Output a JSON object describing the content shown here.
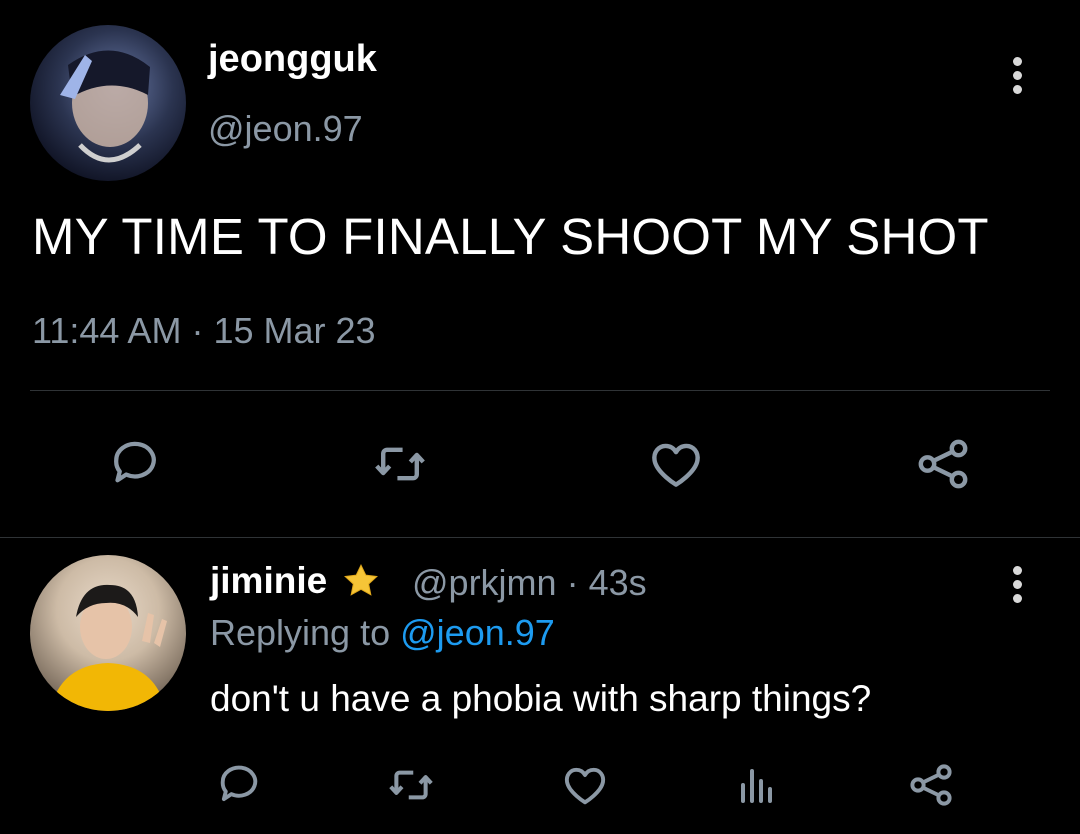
{
  "tweet": {
    "author_name": "jeongguk",
    "author_handle": "@jeon.97",
    "text": "MY TIME TO FINALLY SHOOT MY SHOT",
    "time": "11:44 AM",
    "date": "15 Mar 23",
    "meta_separator": "·"
  },
  "reply": {
    "author_name": "jiminie",
    "author_handle": "@prkjmn",
    "age": "43s",
    "meta_separator": "·",
    "replying_prefix": "Replying to",
    "replying_handle": "@jeon.97",
    "text": "don't u have a phobia with sharp things?"
  },
  "icons": {
    "reply": "reply-icon",
    "retweet": "retweet-icon",
    "like": "heart-icon",
    "share": "share-icon",
    "analytics": "analytics-icon",
    "more": "more-icon",
    "star": "star-emoji"
  },
  "colors": {
    "background": "#000000",
    "text_secondary": "#8b98a5",
    "link": "#1d9bf0",
    "divider": "#2f3336"
  }
}
